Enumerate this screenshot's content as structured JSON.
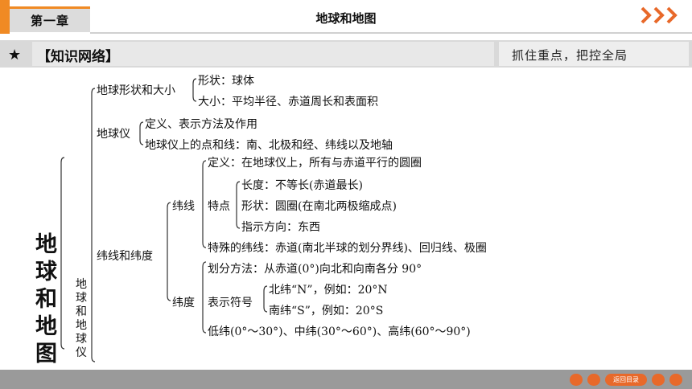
{
  "header": {
    "chapter_label": "第一章",
    "page_title": "地球和地图",
    "accent_color": "#f08a24",
    "next_icon": "triple-chevron-right"
  },
  "banner": {
    "star": "★",
    "title": "【知识网络】",
    "right_text": "抓住重点，把控全局"
  },
  "tree": {
    "root": [
      "地",
      "球",
      "和",
      "地",
      "图"
    ],
    "sub_root": [
      "地",
      "球",
      "和",
      "地",
      "球",
      "仪"
    ],
    "shape": {
      "label": "地球形状和大小",
      "items": [
        "形状：球体",
        "大小：平均半径、赤道周长和表面积"
      ]
    },
    "globe": {
      "label": "地球仪",
      "items": [
        "定义、表示方法及作用",
        "地球仪上的点和线：南、北极和经、纬线以及地轴"
      ]
    },
    "latlon": {
      "label": "纬线和纬度",
      "lat_line": {
        "label": "纬线",
        "definition": "定义：在地球仪上，所有与赤道平行的圆圈",
        "features_label": "特点",
        "features": [
          "长度：不等长(赤道最长)",
          "形状：圆圈(在南北两极缩成点)",
          "指示方向：东西"
        ],
        "special": "特殊的纬线：赤道(南北半球的划分界线)、回归线、极圈"
      },
      "latitude": {
        "label": "纬度",
        "division": "划分方法：从赤道(0°)向北和向南各分 90°",
        "symbol_label": "表示符号",
        "symbols": [
          "北纬“N”，例如：20°N",
          "南纬“S”，例如：20°S"
        ],
        "ranges": "低纬(0°～30°)、中纬(30°～60°)、高纬(60°～90°)"
      }
    }
  },
  "footer": {
    "back_label": "返回目录",
    "button_color": "#e8692a",
    "bar_color": "#9a9a9a"
  }
}
